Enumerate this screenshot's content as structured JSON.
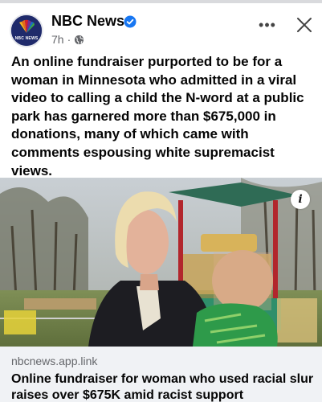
{
  "header": {
    "page_name": "NBC News",
    "avatar_text": "NBC NEWS",
    "time": "7h",
    "dot": "·"
  },
  "post": {
    "lines": [
      "An online fundraiser purported to be for a",
      "woman in Minnesota who admitted in a viral",
      "video to calling a child the N-word at a public",
      "park has garnered more than $675,000 in",
      "donations, many of which came with",
      "comments espousing white supremacist",
      "views."
    ]
  },
  "link": {
    "domain": "nbcnews.app.link",
    "title": "Online fundraiser for woman who used racial slur raises over $675K amid racist support"
  },
  "icons": {
    "verified": "verified-badge-icon",
    "globe": "globe-icon",
    "more": "more-options-icon",
    "close": "close-icon",
    "info": "info-icon",
    "info_glyph": "i",
    "more_glyph": "•••"
  },
  "colors": {
    "verified_blue": "#1877f2",
    "secondary_text": "#65676b",
    "link_card_bg": "#f0f2f5"
  }
}
